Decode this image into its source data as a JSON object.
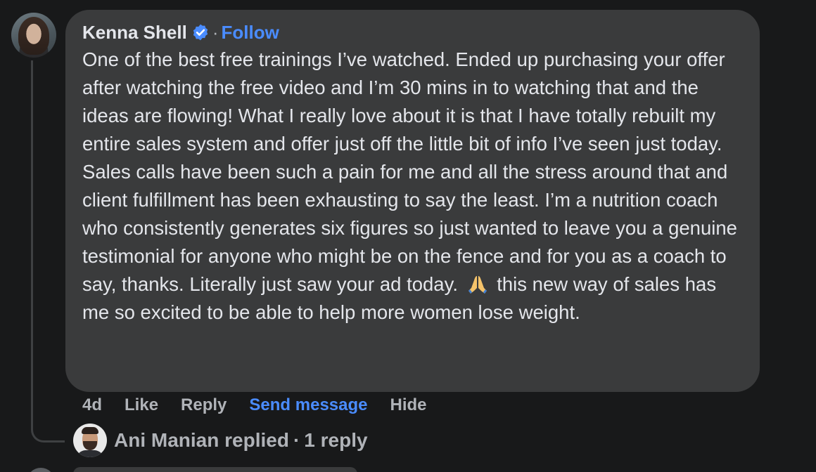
{
  "comment": {
    "author": "Kenna Shell",
    "separator": "·",
    "follow_label": "Follow",
    "text_part1": "One of the best free trainings I’ve watched. Ended up purchasing your offer after watching the free video and I’m 30 mins in to watching that and the ideas are flowing! What I really love about it is that I have totally rebuilt my entire sales system and offer just off the little bit of info I’ve seen just today. Sales calls have been such a pain for me and all the stress around that and client fulfillment has been exhausting to say the least. I’m a nutrition coach who consistently generates six figures so just wanted to leave you a genuine testimonial for anyone who might be on the fence and for you as a coach to say, thanks. Literally just saw your ad today.",
    "emoji_icon": "folded-hands-icon",
    "text_part2": "this new way of sales has me so excited to be able to help more women lose weight.",
    "verified_icon": "verified-badge-icon",
    "verified_color": "#4a8cff"
  },
  "actions": {
    "time": "4d",
    "like": "Like",
    "reply": "Reply",
    "send_message": "Send message",
    "hide": "Hide"
  },
  "reply_summary": {
    "name": "Ani Manian",
    "verb": "replied",
    "separator": "·",
    "count_label": "1 reply"
  },
  "colors": {
    "background": "#18191a",
    "bubble": "#3a3b3c",
    "primary_text": "#e4e6eb",
    "secondary_text": "#b0b3b8",
    "link": "#4a8cff"
  }
}
